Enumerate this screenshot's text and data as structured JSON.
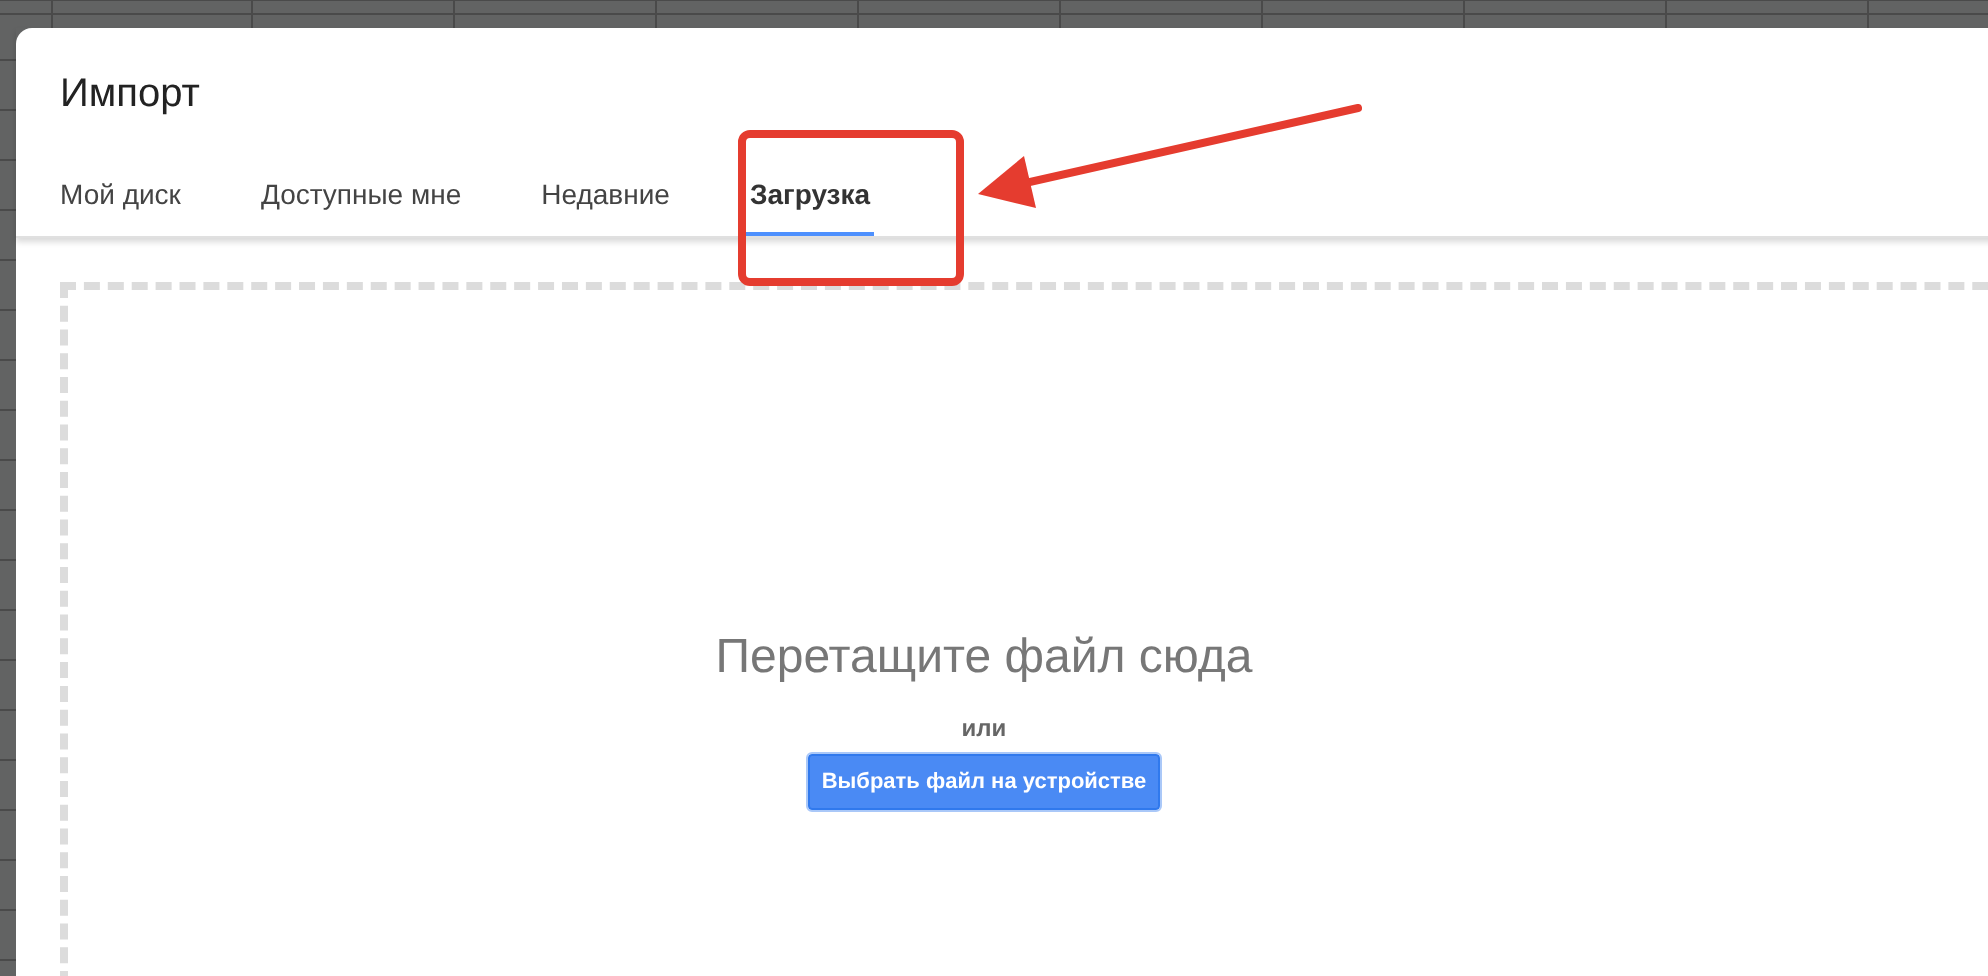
{
  "dialog": {
    "title": "Импорт"
  },
  "tabs": [
    {
      "label": "Мой диск",
      "selected": false,
      "highlighted": false
    },
    {
      "label": "Доступные мне",
      "selected": false,
      "highlighted": false
    },
    {
      "label": "Недавние",
      "selected": false,
      "highlighted": false
    },
    {
      "label": "Загрузка",
      "selected": true,
      "highlighted": true
    }
  ],
  "upload": {
    "heading": "Перетащите файл сюда",
    "separator": "или",
    "button": "Выбрать файл на устройстве"
  }
}
